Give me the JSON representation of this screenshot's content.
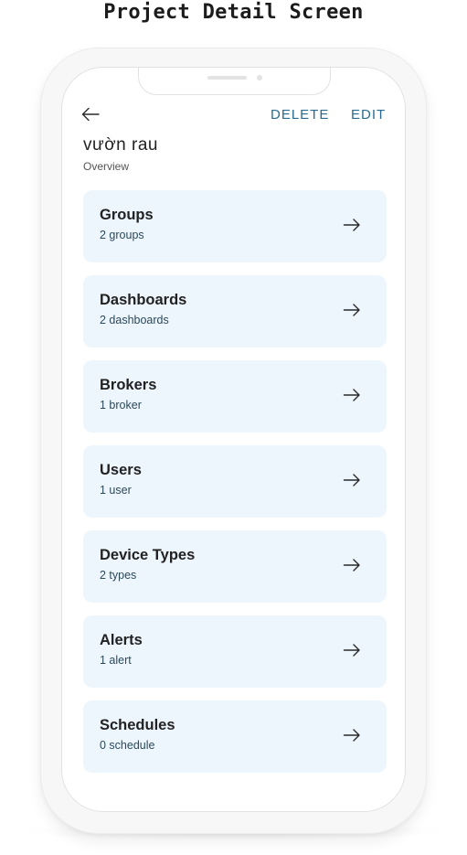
{
  "caption": "Project Detail Screen",
  "header": {
    "back_icon": "arrow-left-icon",
    "delete_label": "DELETE",
    "edit_label": "EDIT"
  },
  "project": {
    "title": "vườn rau",
    "subtitle": "Overview"
  },
  "cards": [
    {
      "title": "Groups",
      "subtitle": "2 groups",
      "icon": "arrow-right-icon"
    },
    {
      "title": "Dashboards",
      "subtitle": "2 dashboards",
      "icon": "arrow-right-icon"
    },
    {
      "title": "Brokers",
      "subtitle": "1 broker",
      "icon": "arrow-right-icon"
    },
    {
      "title": "Users",
      "subtitle": "1 user",
      "icon": "arrow-right-icon"
    },
    {
      "title": "Device Types",
      "subtitle": "2 types",
      "icon": "arrow-right-icon"
    },
    {
      "title": "Alerts",
      "subtitle": "1 alert",
      "icon": "arrow-right-icon"
    },
    {
      "title": "Schedules",
      "subtitle": "0 schedule",
      "icon": "arrow-right-icon"
    }
  ],
  "colors": {
    "accent": "#2b6b8f",
    "card_background": "#edf5fd",
    "title_text": "#222222"
  }
}
